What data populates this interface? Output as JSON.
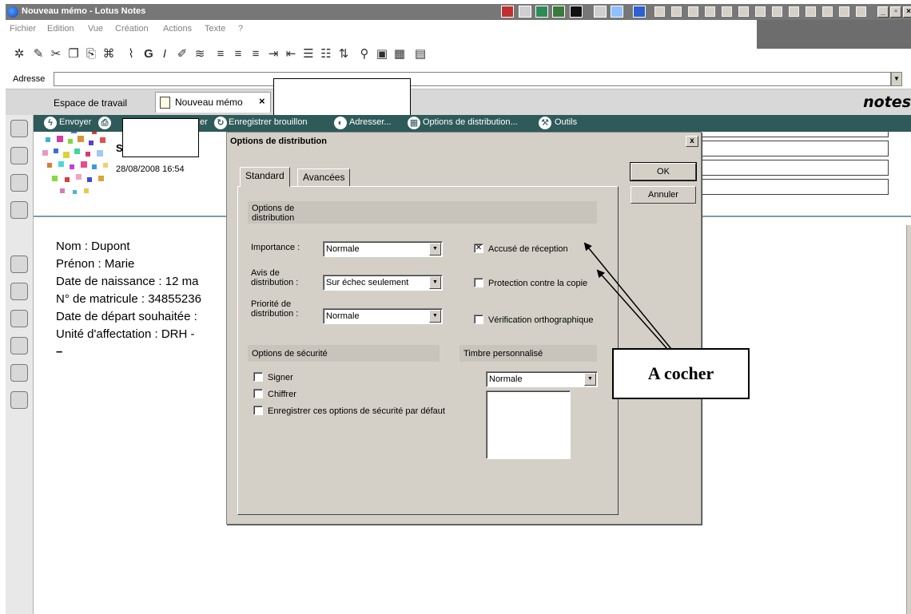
{
  "window": {
    "title": "Nouveau mémo - Lotus Notes"
  },
  "menu": {
    "items": [
      "Fichier",
      "Edition",
      "Vue",
      "Création",
      "Actions",
      "Texte",
      "?"
    ]
  },
  "address": {
    "label": "Adresse"
  },
  "tabs": {
    "workspace": "Espace de travail",
    "memo": "Nouveau mémo",
    "logo": "notes"
  },
  "actions": {
    "send": "Envoyer",
    "send_save_partial": "er",
    "save_draft": "Enregistrer brouillon",
    "address": "Adresser...",
    "delivery_options": "Options de distribution...",
    "tools": "Outils"
  },
  "memo": {
    "sender_initial": "S",
    "date": "28/08/2008 16:54",
    "body": [
      "Nom : Dupont",
      "Prénon : Marie",
      "Date de naissance : 12 ma",
      "N° de matricule : 34855236",
      "Date de départ souhaitée :",
      "Unité d'affectation : DRH -",
      "–"
    ]
  },
  "dialog": {
    "title": "Options de distribution",
    "close": "x",
    "ok": "OK",
    "cancel": "Annuler",
    "tab_standard": "Standard",
    "tab_advanced": "Avancées",
    "section_delivery": "Options de distribution",
    "importance_label": "Importance :",
    "importance_value": "Normale",
    "notice_label": "Avis de distribution :",
    "notice_value": "Sur échec seulement",
    "priority_label": "Priorité de distribution :",
    "priority_value": "Normale",
    "receipt_label": "Accusé de réception",
    "receipt_checked": true,
    "copy_protection_label": "Protection contre la copie",
    "spell_check_label": "Vérification orthographique",
    "section_security": "Options de sécurité",
    "sign_label": "Signer",
    "encrypt_label": "Chiffrer",
    "save_default_label": "Enregistrer ces options de sécurité par défaut",
    "section_stamp": "Timbre personnalisé",
    "stamp_value": "Normale"
  },
  "annotation": {
    "text": "A cocher"
  }
}
